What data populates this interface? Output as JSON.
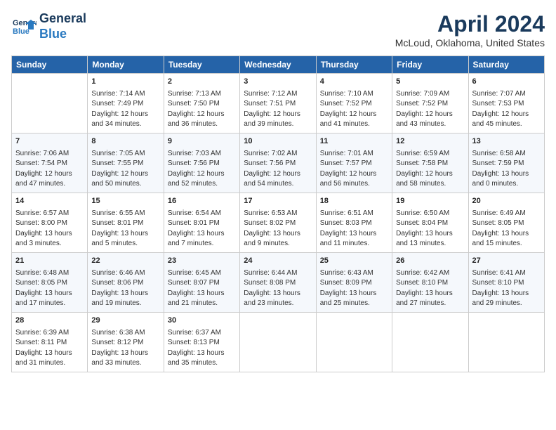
{
  "header": {
    "logo_line1": "General",
    "logo_line2": "Blue",
    "title": "April 2024",
    "subtitle": "McLoud, Oklahoma, United States"
  },
  "days_of_week": [
    "Sunday",
    "Monday",
    "Tuesday",
    "Wednesday",
    "Thursday",
    "Friday",
    "Saturday"
  ],
  "weeks": [
    [
      {
        "day": "",
        "info": ""
      },
      {
        "day": "1",
        "info": "Sunrise: 7:14 AM\nSunset: 7:49 PM\nDaylight: 12 hours\nand 34 minutes."
      },
      {
        "day": "2",
        "info": "Sunrise: 7:13 AM\nSunset: 7:50 PM\nDaylight: 12 hours\nand 36 minutes."
      },
      {
        "day": "3",
        "info": "Sunrise: 7:12 AM\nSunset: 7:51 PM\nDaylight: 12 hours\nand 39 minutes."
      },
      {
        "day": "4",
        "info": "Sunrise: 7:10 AM\nSunset: 7:52 PM\nDaylight: 12 hours\nand 41 minutes."
      },
      {
        "day": "5",
        "info": "Sunrise: 7:09 AM\nSunset: 7:52 PM\nDaylight: 12 hours\nand 43 minutes."
      },
      {
        "day": "6",
        "info": "Sunrise: 7:07 AM\nSunset: 7:53 PM\nDaylight: 12 hours\nand 45 minutes."
      }
    ],
    [
      {
        "day": "7",
        "info": "Sunrise: 7:06 AM\nSunset: 7:54 PM\nDaylight: 12 hours\nand 47 minutes."
      },
      {
        "day": "8",
        "info": "Sunrise: 7:05 AM\nSunset: 7:55 PM\nDaylight: 12 hours\nand 50 minutes."
      },
      {
        "day": "9",
        "info": "Sunrise: 7:03 AM\nSunset: 7:56 PM\nDaylight: 12 hours\nand 52 minutes."
      },
      {
        "day": "10",
        "info": "Sunrise: 7:02 AM\nSunset: 7:56 PM\nDaylight: 12 hours\nand 54 minutes."
      },
      {
        "day": "11",
        "info": "Sunrise: 7:01 AM\nSunset: 7:57 PM\nDaylight: 12 hours\nand 56 minutes."
      },
      {
        "day": "12",
        "info": "Sunrise: 6:59 AM\nSunset: 7:58 PM\nDaylight: 12 hours\nand 58 minutes."
      },
      {
        "day": "13",
        "info": "Sunrise: 6:58 AM\nSunset: 7:59 PM\nDaylight: 13 hours\nand 0 minutes."
      }
    ],
    [
      {
        "day": "14",
        "info": "Sunrise: 6:57 AM\nSunset: 8:00 PM\nDaylight: 13 hours\nand 3 minutes."
      },
      {
        "day": "15",
        "info": "Sunrise: 6:55 AM\nSunset: 8:01 PM\nDaylight: 13 hours\nand 5 minutes."
      },
      {
        "day": "16",
        "info": "Sunrise: 6:54 AM\nSunset: 8:01 PM\nDaylight: 13 hours\nand 7 minutes."
      },
      {
        "day": "17",
        "info": "Sunrise: 6:53 AM\nSunset: 8:02 PM\nDaylight: 13 hours\nand 9 minutes."
      },
      {
        "day": "18",
        "info": "Sunrise: 6:51 AM\nSunset: 8:03 PM\nDaylight: 13 hours\nand 11 minutes."
      },
      {
        "day": "19",
        "info": "Sunrise: 6:50 AM\nSunset: 8:04 PM\nDaylight: 13 hours\nand 13 minutes."
      },
      {
        "day": "20",
        "info": "Sunrise: 6:49 AM\nSunset: 8:05 PM\nDaylight: 13 hours\nand 15 minutes."
      }
    ],
    [
      {
        "day": "21",
        "info": "Sunrise: 6:48 AM\nSunset: 8:05 PM\nDaylight: 13 hours\nand 17 minutes."
      },
      {
        "day": "22",
        "info": "Sunrise: 6:46 AM\nSunset: 8:06 PM\nDaylight: 13 hours\nand 19 minutes."
      },
      {
        "day": "23",
        "info": "Sunrise: 6:45 AM\nSunset: 8:07 PM\nDaylight: 13 hours\nand 21 minutes."
      },
      {
        "day": "24",
        "info": "Sunrise: 6:44 AM\nSunset: 8:08 PM\nDaylight: 13 hours\nand 23 minutes."
      },
      {
        "day": "25",
        "info": "Sunrise: 6:43 AM\nSunset: 8:09 PM\nDaylight: 13 hours\nand 25 minutes."
      },
      {
        "day": "26",
        "info": "Sunrise: 6:42 AM\nSunset: 8:10 PM\nDaylight: 13 hours\nand 27 minutes."
      },
      {
        "day": "27",
        "info": "Sunrise: 6:41 AM\nSunset: 8:10 PM\nDaylight: 13 hours\nand 29 minutes."
      }
    ],
    [
      {
        "day": "28",
        "info": "Sunrise: 6:39 AM\nSunset: 8:11 PM\nDaylight: 13 hours\nand 31 minutes."
      },
      {
        "day": "29",
        "info": "Sunrise: 6:38 AM\nSunset: 8:12 PM\nDaylight: 13 hours\nand 33 minutes."
      },
      {
        "day": "30",
        "info": "Sunrise: 6:37 AM\nSunset: 8:13 PM\nDaylight: 13 hours\nand 35 minutes."
      },
      {
        "day": "",
        "info": ""
      },
      {
        "day": "",
        "info": ""
      },
      {
        "day": "",
        "info": ""
      },
      {
        "day": "",
        "info": ""
      }
    ]
  ]
}
